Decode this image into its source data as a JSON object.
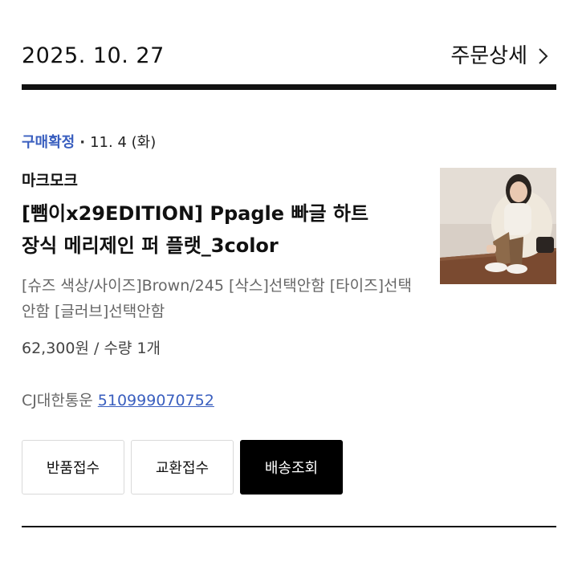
{
  "order": {
    "date": "2025. 10. 27",
    "detail_label": "주문상세"
  },
  "item": {
    "status": "구매확정",
    "separator": "·",
    "status_date": "11. 4 (화)",
    "brand": "마크모크",
    "name_line1": "[뺌이x29EDITION] Ppagle 빠글 하트",
    "name_line2": "장식 메리제인 퍼 플랫_3color",
    "options": "[슈즈 색상/사이즈]Brown/245 [삭스]선택안함 [타이즈]선택안함 [글러브]선택안함",
    "price_qty": "62,300원 / 수량 1개",
    "courier": "CJ대한통운",
    "tracking_number": "510999070752"
  },
  "buttons": {
    "return": "반품접수",
    "exchange": "교환접수",
    "track": "배송조회"
  },
  "icons": {
    "detail_chevron": "chevron-right-icon"
  },
  "colors": {
    "status": "#3a5fbf",
    "link": "#3a5fbf",
    "primary_button": "#000000"
  }
}
